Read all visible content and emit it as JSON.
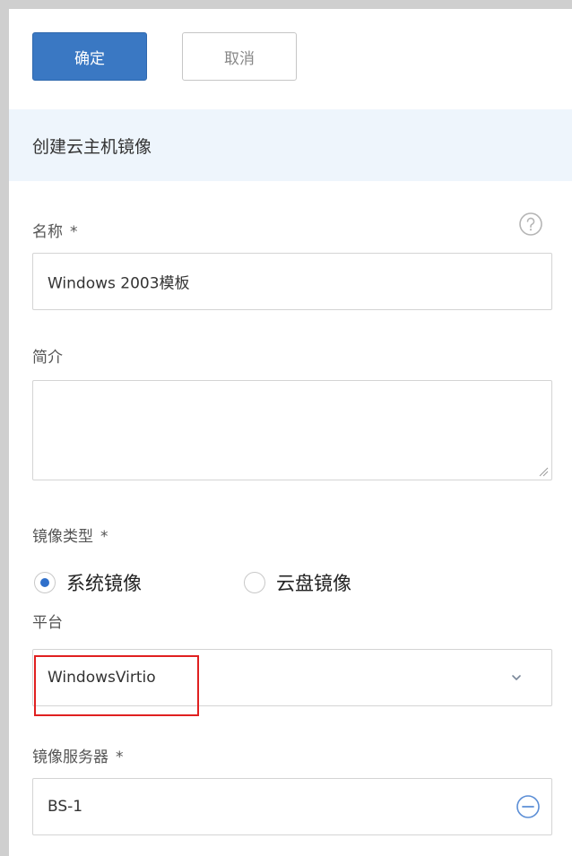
{
  "toolbar": {
    "confirm_label": "确定",
    "cancel_label": "取消"
  },
  "section": {
    "title": "创建云主机镜像"
  },
  "form": {
    "name": {
      "label": "名称",
      "required_mark": "*",
      "value": "Windows 2003模板"
    },
    "description": {
      "label": "简介",
      "value": ""
    },
    "image_type": {
      "label": "镜像类型",
      "required_mark": "*",
      "options": [
        {
          "label": "系统镜像",
          "checked": true
        },
        {
          "label": "云盘镜像",
          "checked": false
        }
      ]
    },
    "platform": {
      "label": "平台",
      "value": "WindowsVirtio"
    },
    "image_server": {
      "label": "镜像服务器",
      "required_mark": "*",
      "value": "BS-1"
    }
  },
  "icons": {
    "help": "help-circle-icon",
    "dropdown": "chevron-down-icon",
    "remove": "minus-circle-icon"
  },
  "colors": {
    "primary": "#3a78c3",
    "header_bg": "#eef5fc",
    "radio_checked": "#2f6fca",
    "highlight": "#e02020"
  }
}
